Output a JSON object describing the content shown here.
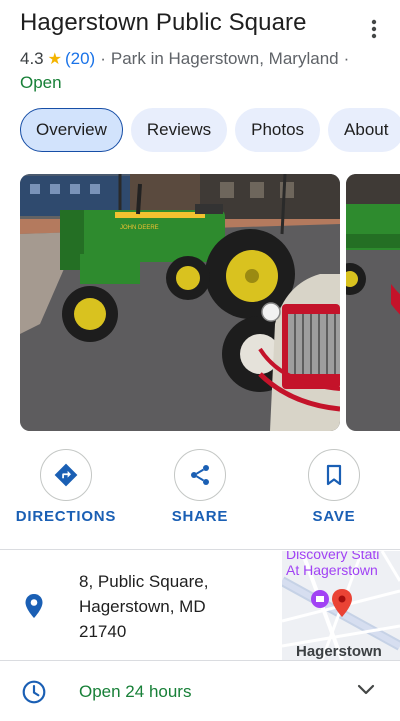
{
  "place": {
    "title": "Hagerstown Public Square",
    "rating": "4.3",
    "star_glyph": "★",
    "review_count": "(20)",
    "separator": "·",
    "category": "Park in Hagerstown, Maryland",
    "status": "Open"
  },
  "tabs": [
    {
      "label": "Overview",
      "active": true
    },
    {
      "label": "Reviews",
      "active": false
    },
    {
      "label": "Photos",
      "active": false
    },
    {
      "label": "About",
      "active": false
    }
  ],
  "photo_text": {
    "tractor_brand": "JOHN DEERE"
  },
  "actions": [
    {
      "label": "DIRECTIONS",
      "icon": "directions-icon"
    },
    {
      "label": "SHARE",
      "icon": "share-icon"
    },
    {
      "label": "SAVE",
      "icon": "bookmark-icon"
    }
  ],
  "address": {
    "line1": "8, Public Square,",
    "line2": "Hagerstown, MD",
    "line3": "21740"
  },
  "map_thumb": {
    "poi_label_1": "Discovery Stati",
    "poi_label_2": "At Hagerstown",
    "city_label": "Hagerstown"
  },
  "hours": {
    "text": "Open 24 hours"
  },
  "colors": {
    "accent": "#1a73e8",
    "open_green": "#188038",
    "action_blue": "#1a5fb4",
    "tab_bg": "#e8eefc",
    "pin_red": "#ea4335"
  }
}
